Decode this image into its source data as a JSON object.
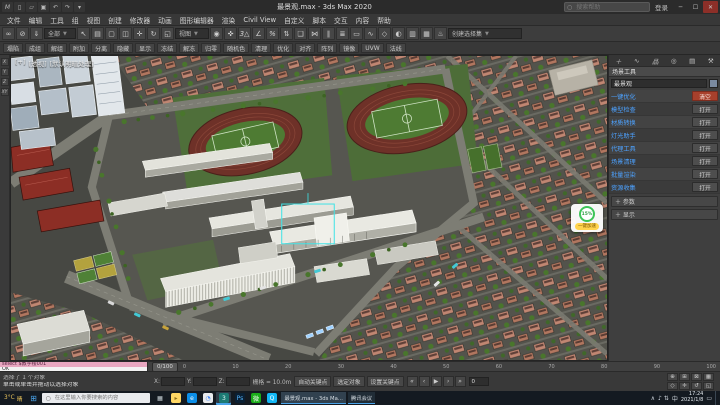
{
  "colors": {
    "accent_blue": "#4da2ff",
    "selection_cyan": "#3fe3e6",
    "stadium_track_red": "#6e3128",
    "field_green": "#4e7b33",
    "building_pink": "#c08672",
    "tree_green": "#49762c",
    "memory_ring_green": "#3ec558",
    "speedup_yellow": "#ffd34d",
    "taskbar_dark": "#141a21"
  },
  "title_bar": {
    "title": "最景观.max - 3ds Max 2020",
    "quick_icons": [
      {
        "name": "max-logo-icon",
        "glyph": "M"
      },
      {
        "name": "new-file-icon",
        "glyph": "▯"
      },
      {
        "name": "open-file-icon",
        "glyph": "▱"
      },
      {
        "name": "save-icon",
        "glyph": "▣"
      },
      {
        "name": "undo-icon",
        "glyph": "↶"
      },
      {
        "name": "redo-icon",
        "glyph": "↷"
      },
      {
        "name": "workspace-dropdown-icon",
        "glyph": "▾"
      }
    ],
    "search_placeholder": "搜索帮助",
    "signin": "登录",
    "window_buttons": {
      "minimize": "─",
      "maximize": "☐",
      "close": "✕"
    }
  },
  "menu_bar": {
    "items": [
      "文件",
      "编辑",
      "工具",
      "组",
      "视图",
      "创建",
      "修改器",
      "动画",
      "图形编辑器",
      "渲染",
      "Civil View",
      "自定义",
      "脚本",
      "交互",
      "内容",
      "帮助"
    ]
  },
  "main_toolbar": {
    "icons_left": [
      {
        "name": "select-link-icon",
        "glyph": "∞"
      },
      {
        "name": "unlink-icon",
        "glyph": "⊘"
      },
      {
        "name": "bind-spacewarp-icon",
        "glyph": "⇓"
      }
    ],
    "filter_value": "全部",
    "icons_mid": [
      {
        "name": "select-object-icon",
        "glyph": "↖"
      },
      {
        "name": "select-by-name-icon",
        "glyph": "▤"
      },
      {
        "name": "rect-region-icon",
        "glyph": "▢"
      },
      {
        "name": "window-crossing-icon",
        "glyph": "◫"
      },
      {
        "name": "select-move-icon",
        "glyph": "✛"
      },
      {
        "name": "select-rotate-icon",
        "glyph": "↻"
      },
      {
        "name": "select-scale-icon",
        "glyph": "◱"
      }
    ],
    "refcoord_value": "视图",
    "icons_right": [
      {
        "name": "use-center-icon",
        "glyph": "◉"
      },
      {
        "name": "select-manipulate-icon",
        "glyph": "✜"
      },
      {
        "name": "snap-toggle-icon",
        "glyph": "3△"
      },
      {
        "name": "angle-snap-icon",
        "glyph": "∠"
      },
      {
        "name": "percent-snap-icon",
        "glyph": "%"
      },
      {
        "name": "spinner-snap-icon",
        "glyph": "⇅"
      },
      {
        "name": "edit-selection-set-icon",
        "glyph": "❑"
      },
      {
        "name": "mirror-icon",
        "glyph": "⋈"
      },
      {
        "name": "align-icon",
        "glyph": "∥"
      },
      {
        "name": "layer-explorer-icon",
        "glyph": "≣"
      },
      {
        "name": "ribbon-toggle-icon",
        "glyph": "▭"
      },
      {
        "name": "curve-editor-icon",
        "glyph": "∿"
      },
      {
        "name": "schematic-view-icon",
        "glyph": "◇"
      },
      {
        "name": "material-editor-icon",
        "glyph": "◐"
      },
      {
        "name": "render-setup-icon",
        "glyph": "▥"
      },
      {
        "name": "rendered-frame-icon",
        "glyph": "▦"
      },
      {
        "name": "render-production-icon",
        "glyph": "♨"
      }
    ],
    "selection_set_value": "创建选择集"
  },
  "tool_row": {
    "buttons": [
      "塌陷",
      "成组",
      "解组",
      "附加",
      "分离",
      "隐藏",
      "显示",
      "冻结",
      "解冻",
      "归零",
      "随机色",
      "清理",
      "优化",
      "对齐",
      "阵列",
      "镜像",
      "UVW",
      "法线"
    ]
  },
  "left_strip": {
    "icons": [
      {
        "name": "axis-x-icon",
        "glyph": "X"
      },
      {
        "name": "axis-y-icon",
        "glyph": "Y"
      },
      {
        "name": "axis-z-icon",
        "glyph": "Z"
      },
      {
        "name": "axis-xy-icon",
        "glyph": "XY"
      }
    ]
  },
  "viewport": {
    "labels": [
      "[+]",
      "[透视]",
      "[默认明暗处理]"
    ]
  },
  "memory_widget": {
    "percent": "15%",
    "action": "一键加速"
  },
  "command_panel": {
    "tabs": [
      {
        "name": "create-tab-icon",
        "glyph": "＋"
      },
      {
        "name": "modify-tab-icon",
        "glyph": "∿"
      },
      {
        "name": "hierarchy-tab-icon",
        "glyph": "品"
      },
      {
        "name": "motion-tab-icon",
        "glyph": "◎"
      },
      {
        "name": "display-tab-icon",
        "glyph": "▤"
      },
      {
        "name": "utilities-tab-icon",
        "glyph": "⚒"
      }
    ],
    "panel_title": "场景工具",
    "object_name": "最景观",
    "rows": [
      {
        "label": "一键优化",
        "button": "清空",
        "btn_style": "background:#a8402c;border-color:#7c2c1e;color:#f5ded7"
      },
      {
        "label": "模型检查",
        "button": "打开"
      },
      {
        "label": "材质转换",
        "button": "打开"
      },
      {
        "label": "灯光助手",
        "button": "打开"
      },
      {
        "label": "代理工具",
        "button": "打开"
      },
      {
        "label": "场景清理",
        "button": "打开"
      },
      {
        "label": "批量渲染",
        "button": "打开"
      },
      {
        "label": "资源收集",
        "button": "打开"
      }
    ],
    "rollouts": [
      "＋ 参数",
      "＋ 显示"
    ]
  },
  "timeline": {
    "slider_label": "0/100",
    "ticks": [
      "0",
      "10",
      "20",
      "30",
      "40",
      "50",
      "60",
      "70",
      "80",
      "90",
      "100"
    ]
  },
  "status_bar": {
    "recorder_line": "select $教学楼001",
    "listener_line": "OK",
    "selection_status": "选择了 1 个对象",
    "prompt": "单击或单击并拖动以选择对象",
    "coords": [
      {
        "name": "coord-x",
        "label": "X:",
        "value": ""
      },
      {
        "name": "coord-y",
        "label": "Y:",
        "value": ""
      },
      {
        "name": "coord-z",
        "label": "Z:",
        "value": ""
      }
    ],
    "grid": "栅格 = 10.0m",
    "autokey": "自动关键点",
    "setkey": "设置关键点",
    "selected_label": "选定对象",
    "frame_value": "0"
  },
  "transport": {
    "icons": [
      {
        "name": "go-start-icon",
        "glyph": "«"
      },
      {
        "name": "prev-frame-icon",
        "glyph": "‹"
      },
      {
        "name": "play-icon",
        "glyph": "▶"
      },
      {
        "name": "next-frame-icon",
        "glyph": "›"
      },
      {
        "name": "go-end-icon",
        "glyph": "»"
      }
    ]
  },
  "nav": {
    "icons": [
      {
        "name": "zoom-icon",
        "glyph": "⊕"
      },
      {
        "name": "zoom-all-icon",
        "glyph": "⊞"
      },
      {
        "name": "zoom-extents-icon",
        "glyph": "⊠"
      },
      {
        "name": "zoom-extents-all-icon",
        "glyph": "▦"
      },
      {
        "name": "fov-icon",
        "glyph": "◇"
      },
      {
        "name": "pan-icon",
        "glyph": "✛"
      },
      {
        "name": "orbit-icon",
        "glyph": "↺"
      },
      {
        "name": "maximize-viewport-icon",
        "glyph": "◱"
      }
    ]
  },
  "taskbar": {
    "weather": {
      "temp": "3°C",
      "desc": "晴"
    },
    "search_placeholder": "在这里输入你要搜索的内容",
    "apps": [
      {
        "name": "task-view-icon",
        "glyph": "▦",
        "style": "color:#cfd8dc"
      },
      {
        "name": "explorer-icon",
        "glyph": "▸",
        "style": "background:#ffd764;color:#8a6d1a"
      },
      {
        "name": "edge-icon",
        "glyph": "e",
        "style": "background:#0b8ee8;color:#fff"
      },
      {
        "name": "chrome-icon",
        "glyph": "◔",
        "style": "background:#e8eaed;color:#4285f4"
      },
      {
        "name": "3dsmax-icon",
        "glyph": "3",
        "style": "background:#1c7a74;color:#d6f5f2",
        "active": "true"
      },
      {
        "name": "photoshop-icon",
        "glyph": "Ps",
        "style": "background:#0a1f33;color:#55b6ff"
      },
      {
        "name": "wechat-icon",
        "glyph": "微",
        "style": "background:#1aad19;color:#fff"
      },
      {
        "name": "qq-icon",
        "glyph": "Q",
        "style": "background:#12b7f5;color:#fff"
      }
    ],
    "windows": [
      {
        "title": "最景观.max - 3ds Ma...",
        "active": "true"
      },
      {
        "title": "腾讯会议",
        "active": "false"
      }
    ],
    "tray": {
      "expand": "∧",
      "icons": [
        {
          "name": "volume-icon",
          "glyph": "♪"
        },
        {
          "name": "network-icon",
          "glyph": "⇅"
        }
      ],
      "ime": "中",
      "time": "17:24",
      "date": "2021/1/8",
      "notification": "▭"
    }
  }
}
